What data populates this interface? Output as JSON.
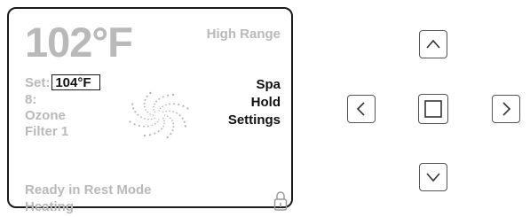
{
  "display": {
    "current_temp": "102°F",
    "range": "High Range",
    "set_label": "Set:",
    "set_value": "104°F",
    "lines": [
      "8:",
      "Ozone",
      "Filter 1"
    ],
    "menu": [
      "Spa",
      "Hold",
      "Settings"
    ],
    "status": "Ready in Rest Mode",
    "heating": "Heating"
  },
  "icons": {
    "lock": "lock-icon",
    "swirl": "pump-swirl-icon",
    "up": "chevron-up-icon",
    "down": "chevron-down-icon",
    "left": "chevron-left-icon",
    "right": "chevron-right-icon",
    "center": "square-icon"
  },
  "colors": {
    "inactive_text": "#b9b9b9",
    "active_text": "#111111",
    "border": "#1a1a1a"
  }
}
